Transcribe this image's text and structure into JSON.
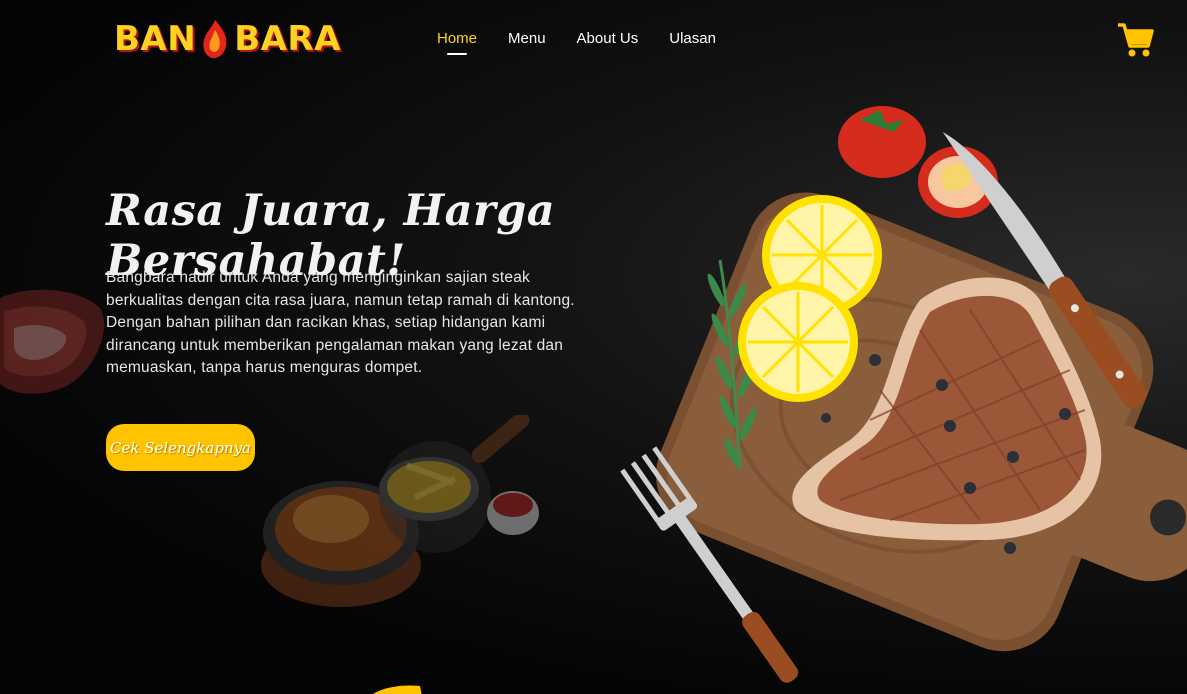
{
  "brand": {
    "logo_left": "BAN",
    "logo_right": "BARA"
  },
  "nav": {
    "items": [
      {
        "label": "Home",
        "active": true
      },
      {
        "label": "Menu",
        "active": false
      },
      {
        "label": "About Us",
        "active": false
      },
      {
        "label": "Ulasan",
        "active": false
      }
    ]
  },
  "cart": {
    "icon": "cart-icon"
  },
  "hero": {
    "title": "Rasa Juara, Harga Bersahabat!",
    "description": "Bangbara hadir untuk Anda yang menginginkan sajian steak berkualitas dengan cita rasa juara, namun tetap ramah di kantong. Dengan bahan pilihan dan racikan khas, setiap hidangan kami dirancang untuk memberikan pengalaman makan yang lezat dan memuaskan, tanpa harus menguras dompet.",
    "cta_label": "Cek Selengkapnya"
  },
  "colors": {
    "accent": "#ffc300",
    "nav_active": "#ffcf25",
    "background": "#050505"
  }
}
